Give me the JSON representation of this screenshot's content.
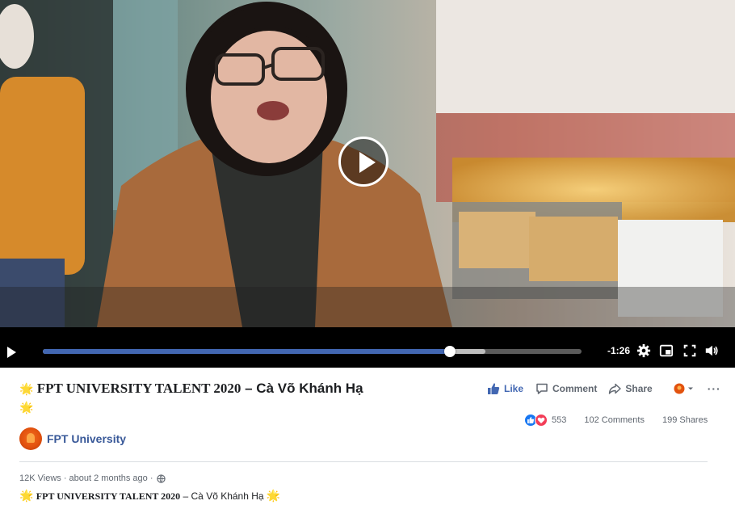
{
  "video": {
    "time_remaining": "-1:26",
    "progress": 0.756,
    "buffered": 0.822
  },
  "post": {
    "title_serif": "FPT UNIVERSITY TALENT 2020",
    "title_sep": " – ",
    "title_name": "Cà Võ Khánh Hạ",
    "page_name": "FPT University",
    "meta": "12K Views · about 2 months ago ·",
    "desc_serif": "FPT UNIVERSITY TALENT 2020",
    "desc_rest": " – Cà Võ Khánh Hạ "
  },
  "actions": {
    "like": "Like",
    "comment": "Comment",
    "share": "Share",
    "more": "···"
  },
  "stats": {
    "reactions": "553",
    "comments": "102 Comments",
    "shares": "199 Shares"
  },
  "colors": {
    "accent": "#4267b2",
    "link": "#385898",
    "text_muted": "#606770"
  },
  "icons": {
    "sun": "sun-emoji-icon",
    "globe": "globe-icon"
  }
}
